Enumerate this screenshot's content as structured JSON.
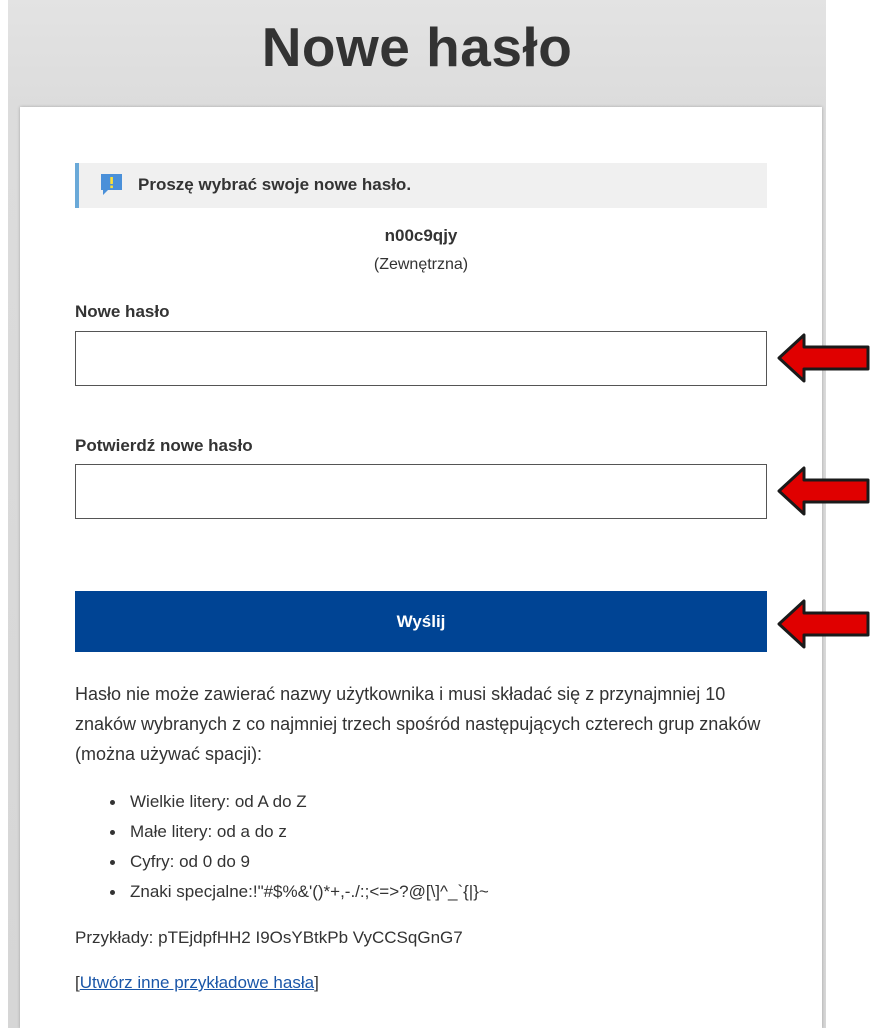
{
  "header": {
    "title": "Nowe hasło"
  },
  "notice": {
    "icon": "exclamation-icon",
    "text": "Proszę wybrać swoje nowe hasło."
  },
  "user": {
    "username": "n00c9qjy",
    "type": "(Zewnętrzna)"
  },
  "form": {
    "new_password": {
      "label": "Nowe hasło",
      "value": ""
    },
    "confirm_password": {
      "label": "Potwierdź nowe hasło",
      "value": ""
    },
    "submit_label": "Wyślij"
  },
  "rules": {
    "intro": "Hasło nie może zawierać nazwy użytkownika i musi składać się z przynajmniej 10 znaków wybranych z co najmniej trzech spośród następujących czterech grup znaków (można używać spacji):",
    "items": [
      "Wielkie litery: od A do Z",
      "Małe litery: od a do z",
      "Cyfry: od 0 do 9",
      "Znaki specjalne:!\"#$%&'()*+,-./:;<=>?@[\\]^_`{|}~"
    ]
  },
  "examples": {
    "label": "Przykłady:",
    "values": "pTEjdpfHH2 I9OsYBtkPb VyCCSqGnG7"
  },
  "generate_link": {
    "open": "[",
    "text": "Utwórz inne przykładowe hasła",
    "close": "]"
  },
  "colors": {
    "accent": "#004494",
    "info_border": "#6aa9d8",
    "annotation_arrow": "#e00000",
    "link": "#1a56a8"
  }
}
